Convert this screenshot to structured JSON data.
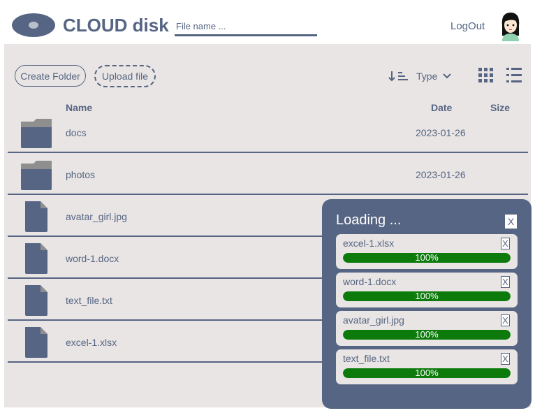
{
  "header": {
    "title": "CLOUD disk",
    "search_placeholder": "File name ...",
    "logout_label": "LogOut"
  },
  "toolbar": {
    "create_folder_label": "Create Folder",
    "upload_file_label": "Upload file",
    "sort_label": "Type"
  },
  "columns": {
    "name": "Name",
    "date": "Date",
    "size": "Size"
  },
  "files": [
    {
      "name": "docs",
      "date": "2023-01-26",
      "kind": "folder",
      "icon": "folder-icon"
    },
    {
      "name": "photos",
      "date": "2023-01-26",
      "kind": "folder",
      "icon": "folder-icon"
    },
    {
      "name": "avatar_girl.jpg",
      "date": "",
      "kind": "file",
      "icon": "file-icon"
    },
    {
      "name": "word-1.docx",
      "date": "",
      "kind": "file",
      "icon": "file-icon"
    },
    {
      "name": "text_file.txt",
      "date": "",
      "kind": "file",
      "icon": "file-icon"
    },
    {
      "name": "excel-1.xlsx",
      "date": "",
      "kind": "file",
      "icon": "file-icon"
    }
  ],
  "uploader": {
    "title": "Loading ...",
    "close_label": "X",
    "items": [
      {
        "name": "excel-1.xlsx",
        "progress": "100%",
        "close": "X",
        "progress_value": 1.0
      },
      {
        "name": "word-1.docx",
        "progress": "100%",
        "close": "X",
        "progress_value": 1.0
      },
      {
        "name": "avatar_girl.jpg",
        "progress": "100%",
        "close": "X",
        "progress_value": 1.0
      },
      {
        "name": "text_file.txt",
        "progress": "100%",
        "close": "X",
        "progress_value": 1.0
      }
    ]
  },
  "colors": {
    "accent": "#566583",
    "background": "#e9e5e4",
    "progress": "#0c7b0b"
  }
}
